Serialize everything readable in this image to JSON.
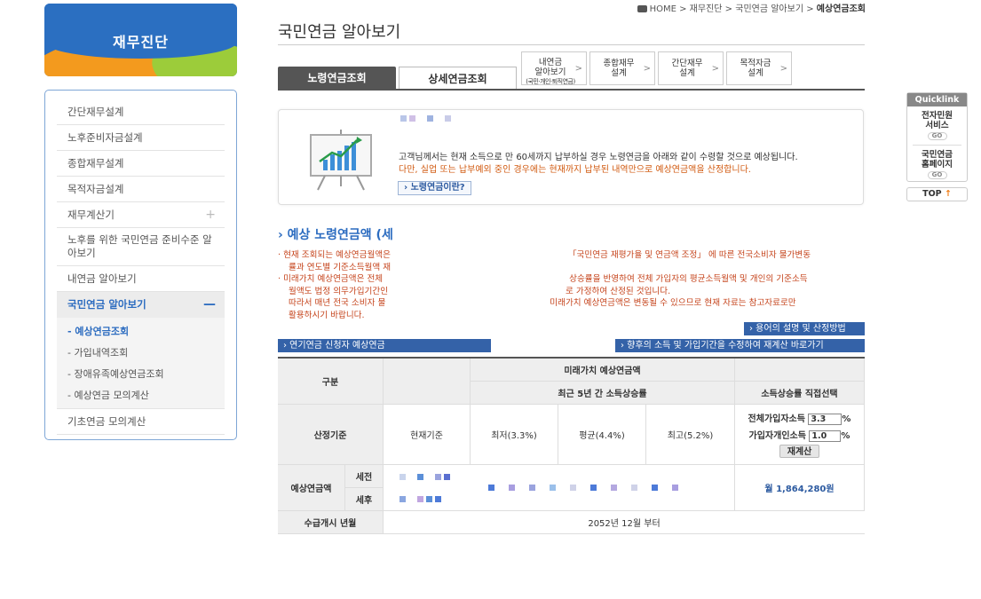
{
  "brand": {
    "title": "재무진단"
  },
  "sidebar": {
    "items": [
      {
        "label": "간단재무설계"
      },
      {
        "label": "노후준비자금설계"
      },
      {
        "label": "종합재무설계"
      },
      {
        "label": "목적자금설계"
      },
      {
        "label": "재무계산기",
        "plus": "+"
      },
      {
        "label": "노후를 위한 국민연금 준비수준 알아보기"
      },
      {
        "label": "내연금 알아보기"
      },
      {
        "label": "국민연금 알아보기",
        "minus": "—"
      },
      {
        "label": "기초연금 모의계산"
      }
    ],
    "sub": [
      "- 예상연금조회",
      "- 가입내역조회",
      "- 장애유족예상연금조회",
      "- 예상연금 모의계산"
    ]
  },
  "breadcrumb": {
    "home": "HOME",
    "c1": "재무진단",
    "c2": "국민연금 알아보기",
    "c3": "예상연금조회",
    "sep": ">"
  },
  "page": {
    "title": "국민연금 알아보기"
  },
  "tabs": {
    "main1": "노령연금조회",
    "main2": "상세연금조회",
    "small": [
      {
        "l1": "내연금",
        "l2": "알아보기",
        "l3": "(국민·개인·퇴직연금)"
      },
      {
        "l1": "종합재무",
        "l2": "설계"
      },
      {
        "l1": "간단재무",
        "l2": "설계"
      },
      {
        "l1": "목적자금",
        "l2": "설계"
      }
    ],
    "arrow": ">"
  },
  "info": {
    "line1": "고객님께서는 현재 소득으로 만 60세까지 납부하실 경우 노령연금을 아래와 같이 수령할 것으로 예상됩니다.",
    "line2": "다만, 실업 또는 납부예외 중인 경우에는 현재까지 납부된 내역만으로 예상연금액을 산정합니다.",
    "button": "› 노령연금이란?"
  },
  "section": {
    "title": "› 예상 노령연금액 (세"
  },
  "notes": {
    "n1a": "· 현재 조회되는 예상연금월액은",
    "n1b": "「국민연금 재평가율 및 연금액 조정」 에 따른 전국소비자 물가변동",
    "n1c": "률과 연도별 기준소득월액 재",
    "n2a": "· 미래가치 예상연금액은 전체",
    "n2b": "상승률을 반영하여 전체 가입자의 평균소득월액 및 개인의 기준소득",
    "n2c": "월액도 법정 의무가입기간인",
    "n2d": "로 가정하여 산정된 것입니다.",
    "n3a": "따라서 매년 전국 소비자 물",
    "n3b": "미래가치 예상연금액은 변동될 수 있으므로 현재 자료는 참고자료로만",
    "n3c": "활용하시기 바랍니다."
  },
  "buttons": {
    "terms": "› 용어의 설명 및 산정방법",
    "applicant": "› 연기연금 신청자 예상연금",
    "recalc_link": "› 향후의 소득 및 가입기간을 수정하여 재계산 바로가기"
  },
  "table": {
    "h_gubun": "구분",
    "h_future": "미래가치 예상연금액",
    "h_recent": "최근 5년 간 소득상승률",
    "h_direct": "소득상승률 직접선택",
    "h_basis": "산정기준",
    "h_current": "현재기준",
    "h_min": "최저(3.3%)",
    "h_avg": "평균(4.4%)",
    "h_max": "최고(5.2%)",
    "lbl_all": "전체가입자소득",
    "val_all": "3.3",
    "lbl_personal": "가입자개인소득",
    "val_personal": "1.0",
    "pct": "%",
    "recalc": "재계산",
    "row_amount": "예상연금액",
    "pre_tax": "세전",
    "after_tax": "세후",
    "amount": "월 1,864,280원",
    "row_start": "수급개시 년월",
    "start_val": "2052년 12월 부터"
  },
  "quick": {
    "title": "Quicklink",
    "l1a": "전자민원",
    "l1b": "서비스",
    "l2a": "국민연금",
    "l2b": "홈페이지",
    "go": "GO"
  },
  "top": {
    "label": "TOP",
    "arrow": "↑"
  },
  "colors": {
    "accent": "#2c6cc0",
    "warning": "#c5431b",
    "button": "#3462a8"
  }
}
